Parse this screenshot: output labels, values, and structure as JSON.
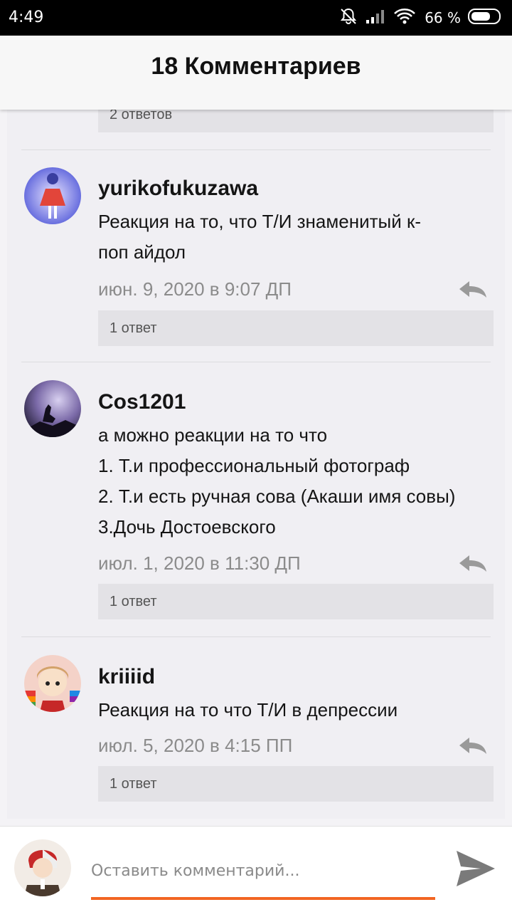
{
  "status_bar": {
    "time": "4:49",
    "battery_percent": "66 %"
  },
  "header": {
    "title": "18 Комментариев"
  },
  "prev_replies": {
    "label": "2 ответов"
  },
  "comments": [
    {
      "username": "yurikofukuzawa",
      "lines": [
        "Реакция на то, что Т/И знаменитый к-",
        "поп айдол"
      ],
      "date": "июн. 9, 2020 в 9:07 ДП",
      "replies": "1 ответ",
      "avatar": "anime-girl-red-dress"
    },
    {
      "username": "Cos1201",
      "lines": [
        "а можно реакции на то что",
        "1. Т.и  профессиональный фотограф",
        "2. Т.и есть ручная сова (Акаши имя совы)",
        "3.Дочь Достоевского"
      ],
      "date": "июл. 1, 2020 в 11:30 ДП",
      "replies": "1 ответ",
      "avatar": "howling-wolf-night"
    },
    {
      "username": "kriiiid",
      "lines": [
        "Реакция на то что Т/И в депрессии"
      ],
      "date": "июл. 5, 2020 в 4:15 ПП",
      "replies": "1 ответ",
      "avatar": "anime-girl-rainbow"
    }
  ],
  "composer": {
    "placeholder": "Оставить комментарий...",
    "accent_color": "#f26522"
  }
}
